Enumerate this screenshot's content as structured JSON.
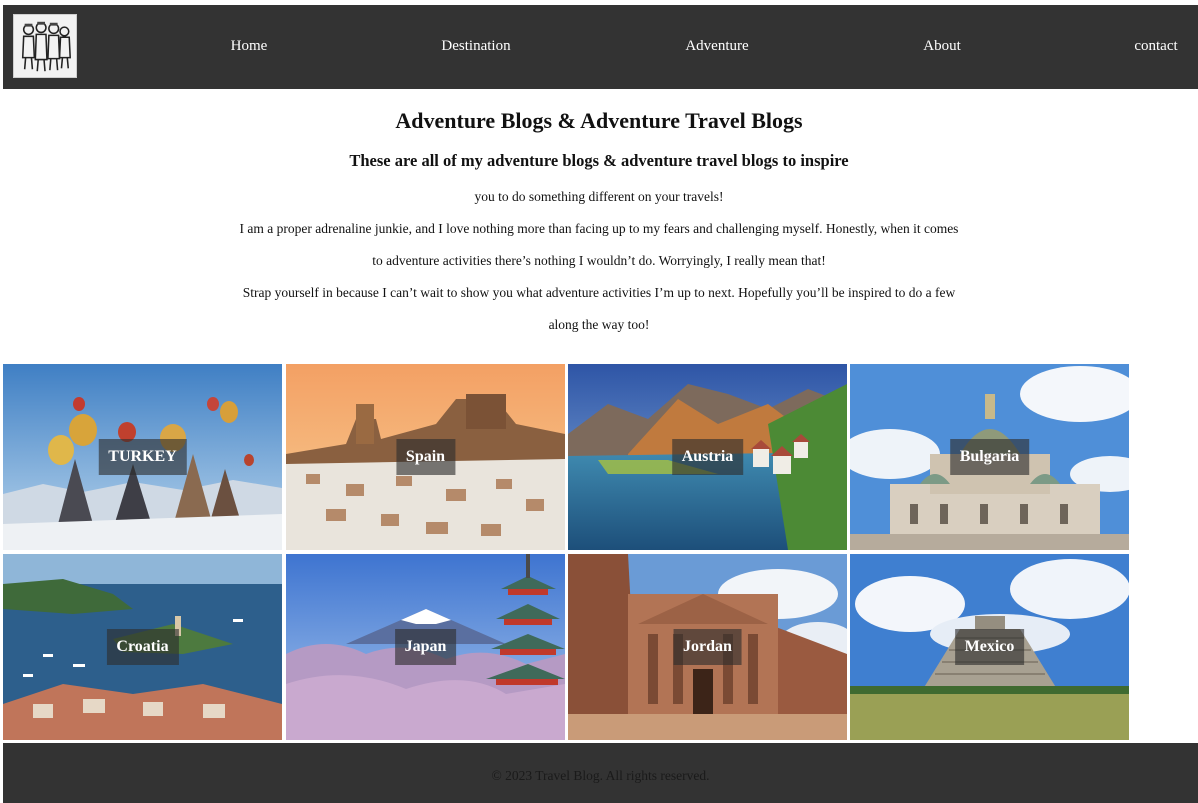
{
  "nav": {
    "logo_icon": "cartoon-travelers-logo-icon",
    "items": [
      {
        "label": "Home"
      },
      {
        "label": "Destination"
      },
      {
        "label": "Adventure"
      },
      {
        "label": "About"
      },
      {
        "label": "contact"
      }
    ],
    "background_color": "#333333",
    "text_color": "#ffffff"
  },
  "intro": {
    "title": "Adventure Blogs & Adventure Travel Blogs",
    "subtitle": "These are all of my adventure blogs & adventure travel blogs to inspire",
    "lines": [
      "you to do something different on your travels!",
      "I am a proper adrenaline junkie, and I love nothing more than facing up to my fears and challenging myself. Honestly, when it comes",
      "to adventure activities there’s nothing I wouldn’t do. Worryingly, I really mean that!",
      "Strap yourself in because I can’t wait to show you what adventure activities I’m up to next. Hopefully you’ll be inspired to do a few",
      "along the way too!"
    ]
  },
  "destinations": [
    {
      "label": "TURKEY",
      "image_icon": "hot-air-balloons-cappadocia-image"
    },
    {
      "label": "Spain",
      "image_icon": "whitewashed-hill-town-sunset-image"
    },
    {
      "label": "Austria",
      "image_icon": "alpine-lake-village-image"
    },
    {
      "label": "Bulgaria",
      "image_icon": "domed-cathedral-image"
    },
    {
      "label": "Croatia",
      "image_icon": "coastal-bay-town-image"
    },
    {
      "label": "Japan",
      "image_icon": "pagoda-mount-fuji-cherry-blossom-image"
    },
    {
      "label": "Jordan",
      "image_icon": "petra-treasury-image"
    },
    {
      "label": "Mexico",
      "image_icon": "chichen-itza-pyramid-image"
    }
  ],
  "footer": {
    "text": "© 2023 Travel Blog. All rights reserved.",
    "background_color": "#333333"
  }
}
